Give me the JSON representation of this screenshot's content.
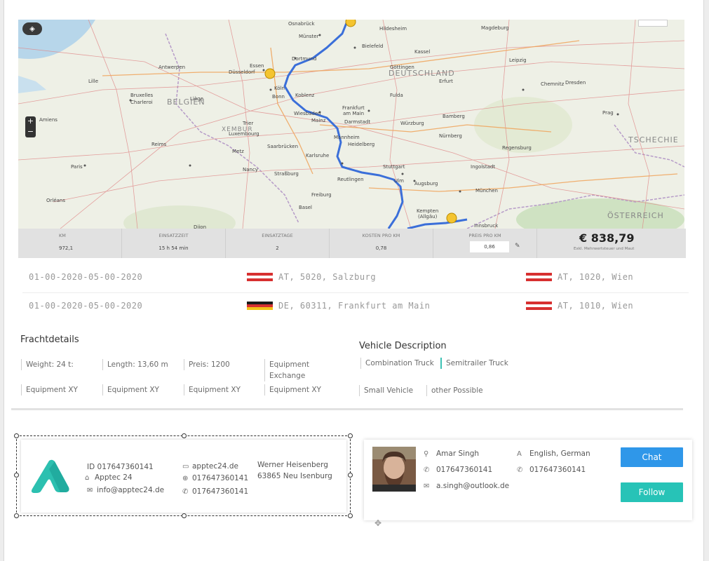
{
  "map": {
    "labels": {
      "deutschland": "DEUTSCHLAND",
      "belgien": "BELGIEN",
      "tschechien": "TSCHECHIE",
      "oesterreich": "ÖSTERREICH",
      "luxemburg": "XEMBUR"
    },
    "cities": [
      {
        "name": "Münster"
      },
      {
        "name": "Bielefeld"
      },
      {
        "name": "Dortmund"
      },
      {
        "name": "Essen"
      },
      {
        "name": "Düsseldorf"
      },
      {
        "name": "Köln"
      },
      {
        "name": "Bonn"
      },
      {
        "name": "Kassel"
      },
      {
        "name": "Erfurt"
      },
      {
        "name": "Leipzig"
      },
      {
        "name": "Dresden"
      },
      {
        "name": "Chemnitz"
      },
      {
        "name": "Frankfurt am Main"
      },
      {
        "name": "Wiesbaden"
      },
      {
        "name": "Mainz"
      },
      {
        "name": "Darmstadt"
      },
      {
        "name": "Mannheim"
      },
      {
        "name": "Heidelberg"
      },
      {
        "name": "Karlsruhe"
      },
      {
        "name": "Stuttgart"
      },
      {
        "name": "Ulm"
      },
      {
        "name": "Augsburg"
      },
      {
        "name": "München"
      },
      {
        "name": "Nürnberg"
      },
      {
        "name": "Würzburg"
      },
      {
        "name": "Regensburg"
      },
      {
        "name": "Ingolstadt"
      },
      {
        "name": "Strasbourg"
      },
      {
        "name": "Nancy"
      },
      {
        "name": "Metz"
      },
      {
        "name": "Luxembourg"
      },
      {
        "name": "Saarbrücken"
      },
      {
        "name": "Paris"
      },
      {
        "name": "Reims"
      },
      {
        "name": "Lille"
      },
      {
        "name": "Bruxelles"
      },
      {
        "name": "Antwerpen"
      },
      {
        "name": "Liège"
      },
      {
        "name": "Charleroi"
      },
      {
        "name": "Basel"
      },
      {
        "name": "Freiburg"
      },
      {
        "name": "Kempten (Allgäu)"
      },
      {
        "name": "Innsbruck"
      },
      {
        "name": "Prag"
      },
      {
        "name": "Magdeburg"
      },
      {
        "name": "Hildesheim"
      },
      {
        "name": "Osnabrück"
      },
      {
        "name": "Fulda"
      },
      {
        "name": "Bamberg"
      },
      {
        "name": "Göttingen"
      },
      {
        "name": "Koblenz"
      },
      {
        "name": "Trier"
      },
      {
        "name": "Orléans"
      },
      {
        "name": "Amiens"
      },
      {
        "name": "Dijon"
      },
      {
        "name": "Reutlingen"
      }
    ],
    "corner_button": "",
    "zoom_in": "+",
    "zoom_out": "−"
  },
  "stats": [
    {
      "label": "KM",
      "value": "972,1"
    },
    {
      "label": "EINSATZZEIT",
      "value": "15 h 54 min"
    },
    {
      "label": "EINSATZTAGE",
      "value": "2"
    },
    {
      "label": "KOSTEN PRO KM",
      "value": "0,78"
    },
    {
      "label": "PREIS PRO KM",
      "value": "0,86"
    }
  ],
  "total": {
    "amount": "€ 838,79",
    "note": "Exkl. Mehrwertsteuer und Maut"
  },
  "routes": [
    {
      "date": "01-00-2020-05-00-2020",
      "from": "AT, 5020, Salzburg",
      "from_flag": "AT",
      "to": "AT, 1020, Wien",
      "to_flag": "AT"
    },
    {
      "date": "01-00-2020-05-00-2020",
      "from": "DE, 60311, Frankfurt am Main",
      "from_flag": "DE",
      "to": "AT, 1010, Wien",
      "to_flag": "AT"
    }
  ],
  "fracht": {
    "title": "Frachtdetails",
    "chips": [
      "Weight: 24 t:",
      "Length: 13,60 m",
      "Preis: 1200",
      "Equipment Exchange",
      "Equipment XY",
      "Equipment XY",
      "Equipment XY",
      "Equipment XY"
    ]
  },
  "vehicle": {
    "title": "Vehicle Description",
    "chips": [
      "Combination Truck",
      "Semitrailer Truck",
      "Small Vehicle",
      "other Possible"
    ]
  },
  "company": {
    "id": "ID  017647360141",
    "name": "Apptec 24",
    "email": "info@apptec24.de",
    "website": "apptec24.de",
    "phone1": "017647360141",
    "phone2": "017647360141",
    "contact": "Werner Heisenberg",
    "address": "63865 Neu Isenburg"
  },
  "person": {
    "name": "Amar Singh",
    "phone": "017647360141",
    "email": "a.singh@outlook.de",
    "languages": "English, German",
    "phone2": "017647360141",
    "chat_label": "Chat",
    "follow_label": "Follow"
  },
  "colors": {
    "route": "#3b6fd9",
    "chat": "#2f97e9",
    "follow": "#27c3b7",
    "flag_red": "#d73030"
  }
}
